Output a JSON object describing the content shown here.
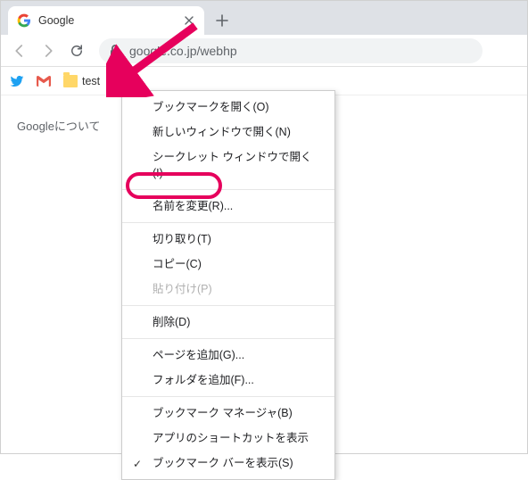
{
  "tab": {
    "title": "Google"
  },
  "toolbar": {
    "url": "google.co.jp/webhp"
  },
  "bookmarks": {
    "twitter": "",
    "gmail": "",
    "folder_label": "test"
  },
  "page": {
    "about": "Googleについて"
  },
  "menu": {
    "open_bookmark": "ブックマークを開く(O)",
    "open_new_window": "新しいウィンドウで開く(N)",
    "open_incognito": "シークレット ウィンドウで開く(I)",
    "rename": "名前を変更(R)...",
    "cut": "切り取り(T)",
    "copy": "コピー(C)",
    "paste": "貼り付け(P)",
    "delete": "削除(D)",
    "add_page": "ページを追加(G)...",
    "add_folder": "フォルダを追加(F)...",
    "bookmark_manager": "ブックマーク マネージャ(B)",
    "show_app_shortcut": "アプリのショートカットを表示",
    "show_bookmark_bar": "ブックマーク バーを表示(S)"
  }
}
